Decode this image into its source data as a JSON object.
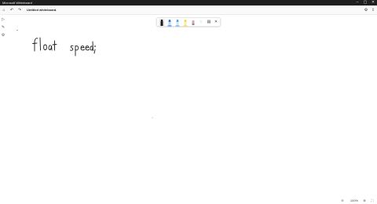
{
  "window": {
    "app_title": "Microsoft Whiteboard",
    "controls": [
      "minimize-icon",
      "maximize-icon",
      "close-icon"
    ]
  },
  "appbar": {
    "board_title": "Untitled whiteboard",
    "caret": "⌄",
    "left_icons": [
      "home-icon",
      "undo-icon",
      "redo-icon"
    ],
    "right_icons": [
      "board-settings-icon",
      "share-icon"
    ]
  },
  "sidebar": {
    "icons": [
      "select-icon",
      "pen-icon",
      "gear-icon"
    ]
  },
  "toolbar": {
    "pens": [
      {
        "name": "black-pen",
        "color": "#1b1b1b",
        "active": true
      },
      {
        "name": "blue-pen",
        "color": "#2d7fd8"
      },
      {
        "name": "blue-highlighter",
        "color": "#52a6ea"
      },
      {
        "name": "yellow-highlighter",
        "color": "#f1d84a"
      }
    ],
    "icons": [
      "eraser-icon",
      "lasso-icon",
      "ruler-icon",
      "close-toolbar-icon"
    ]
  },
  "canvas": {
    "ink_text": [
      "float",
      "speed;"
    ]
  },
  "statusbar": {
    "zoom_level": "100%",
    "icons": [
      "zoom-out-icon",
      "zoom-in-icon",
      "fit-to-screen-icon"
    ]
  },
  "colors": {
    "titlebar": "#1f1f1f",
    "ink": "#1b1b1b"
  }
}
